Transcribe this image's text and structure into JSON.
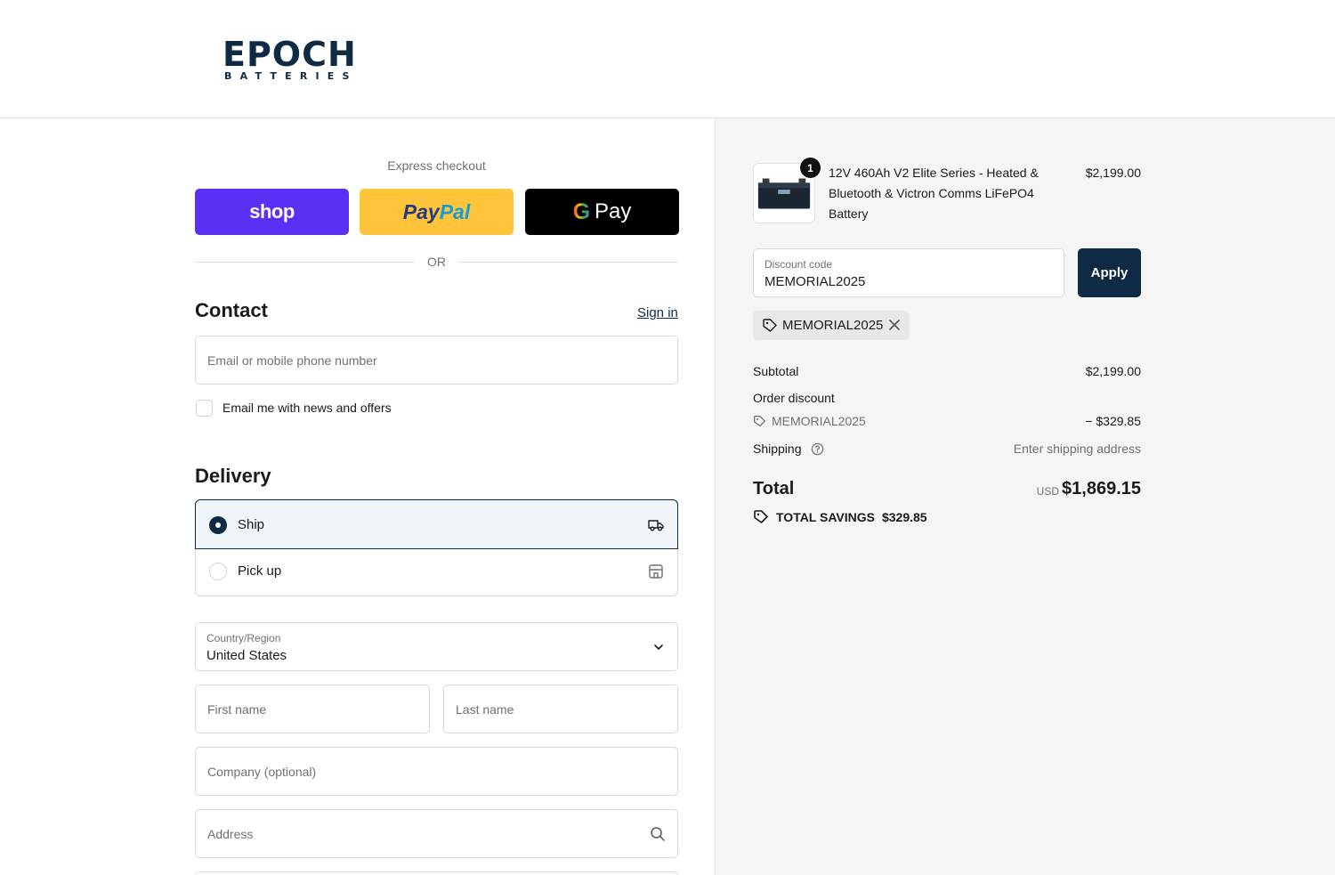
{
  "brand": {
    "logo_main": "EPOCH",
    "logo_sub": "BATTERIES",
    "accent_color": "#0f2a44",
    "logo_accent_color": "#e53935"
  },
  "express": {
    "label": "Express checkout",
    "shop_label": "shop",
    "paypal_label_1": "Pay",
    "paypal_label_2": "Pal",
    "gpay_g": "G",
    "gpay_label": "Pay",
    "or_text": "OR"
  },
  "contact": {
    "title": "Contact",
    "signin_label": "Sign in",
    "email_placeholder": "Email or mobile phone number",
    "news_label": "Email me with news and offers"
  },
  "delivery": {
    "title": "Delivery",
    "options": [
      {
        "label": "Ship",
        "selected": true,
        "icon": "truck-icon"
      },
      {
        "label": "Pick up",
        "selected": false,
        "icon": "store-icon"
      }
    ],
    "country_label": "Country/Region",
    "country_value": "United States",
    "first_name_placeholder": "First name",
    "last_name_placeholder": "Last name",
    "company_placeholder": "Company (optional)",
    "address_placeholder": "Address"
  },
  "cart": {
    "item": {
      "name": "12V 460Ah V2 Elite Series - Heated & Bluetooth & Victron Comms LiFePO4 Battery",
      "price": "$2,199.00",
      "quantity": "1"
    },
    "discount": {
      "label": "Discount code",
      "value": "MEMORIAL2025",
      "apply_label": "Apply",
      "applied_code": "MEMORIAL2025"
    },
    "summary": {
      "subtotal_label": "Subtotal",
      "subtotal_value": "$2,199.00",
      "order_discount_label": "Order discount",
      "discount_code": "MEMORIAL2025",
      "discount_value": "− $329.85",
      "shipping_label": "Shipping",
      "shipping_value": "Enter shipping address",
      "total_label": "Total",
      "total_currency": "USD",
      "total_value": "$1,869.15",
      "savings_label": "TOTAL SAVINGS",
      "savings_value": "$329.85"
    }
  }
}
